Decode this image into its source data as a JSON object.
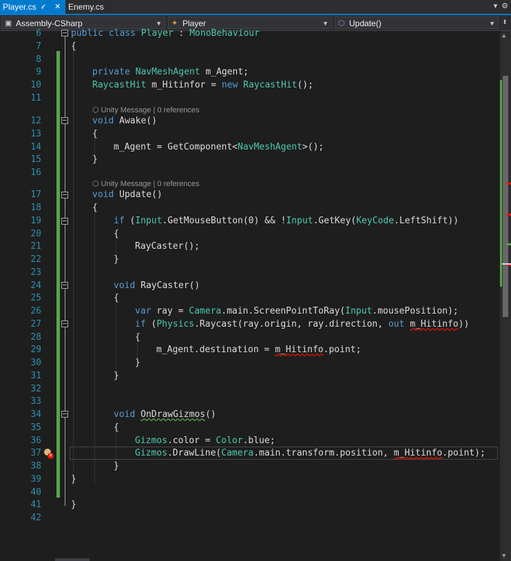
{
  "tabs": [
    {
      "label": "Player.cs",
      "active": true
    },
    {
      "label": "Enemy.cs",
      "active": false
    }
  ],
  "tabbar_icons": [
    "pin-icon",
    "close-icon",
    "gear-icon"
  ],
  "navbar": {
    "project": "Assembly-CSharp",
    "class": "Player",
    "member": "Update()"
  },
  "code_lens": {
    "awake": "⬡ Unity Message | 0 references",
    "update": "⬡ Unity Message | 0 references"
  },
  "line_numbers": [
    "6",
    "7",
    "8",
    "9",
    "10",
    "11",
    "12",
    "13",
    "14",
    "15",
    "16",
    "17",
    "18",
    "19",
    "20",
    "21",
    "22",
    "23",
    "24",
    "25",
    "26",
    "27",
    "28",
    "29",
    "30",
    "31",
    "32",
    "33",
    "34",
    "35",
    "36",
    "37",
    "38",
    "39",
    "40",
    "41",
    "42"
  ],
  "code": {
    "l6": [
      "public",
      " ",
      "class",
      " ",
      "Player",
      " : ",
      "MonoBehaviour"
    ],
    "l7": [
      "{"
    ],
    "l9": [
      "private",
      " ",
      "NavMeshAgent",
      " m_Agent;"
    ],
    "l10": [
      "RaycastHit",
      " m_Hitinfor = ",
      "new",
      " ",
      "RaycastHit",
      "();"
    ],
    "l12": [
      "void",
      " ",
      "Awake",
      "()"
    ],
    "l13": [
      "{"
    ],
    "l14": [
      "m_Agent = GetComponent<",
      "NavMeshAgent",
      ">();"
    ],
    "l15": [
      "}"
    ],
    "l17": [
      "void",
      " ",
      "Update",
      "()"
    ],
    "l18": [
      "{"
    ],
    "l19": [
      "if",
      " (",
      "Input",
      ".GetMouseButton(0) && !",
      "Input",
      ".GetKey(",
      "KeyCode",
      ".LeftShift))"
    ],
    "l20": [
      "{"
    ],
    "l21": [
      "RayCaster();"
    ],
    "l22": [
      "}"
    ],
    "l24": [
      "void",
      " ",
      "RayCaster",
      "()"
    ],
    "l25": [
      "{"
    ],
    "l26": [
      "var",
      " ray = ",
      "Camera",
      ".main.ScreenPointToRay(",
      "Input",
      ".mousePosition);"
    ],
    "l27": [
      "if",
      " (",
      "Physics",
      ".Raycast(ray.origin, ray.direction, ",
      "out",
      " ",
      "m_Hitinfo",
      "))"
    ],
    "l28": [
      "{"
    ],
    "l29": [
      "m_Agent.destination = ",
      "m_Hitinfo",
      ".point;"
    ],
    "l30": [
      "}"
    ],
    "l31": [
      "}"
    ],
    "l34": [
      "void",
      " ",
      "OnDrawGizmos",
      "()"
    ],
    "l35": [
      "{"
    ],
    "l36": [
      "Gizmos",
      ".color = ",
      "Color",
      ".blue;"
    ],
    "l37": [
      "Gizmos",
      ".DrawLine(",
      "Camera",
      ".main.transform.position, ",
      "m_Hitinfo",
      ".point);"
    ],
    "l38": [
      "}"
    ],
    "l39": [
      "}"
    ],
    "l41": [
      "}"
    ]
  },
  "colors": {
    "keyword": "#569cd6",
    "type": "#4ec9b0",
    "plain": "#dcdcdc",
    "line_number": "#2b91af",
    "error_squiggle": "#e51400",
    "change_bar": "#57a64a",
    "accent": "#007acc"
  }
}
